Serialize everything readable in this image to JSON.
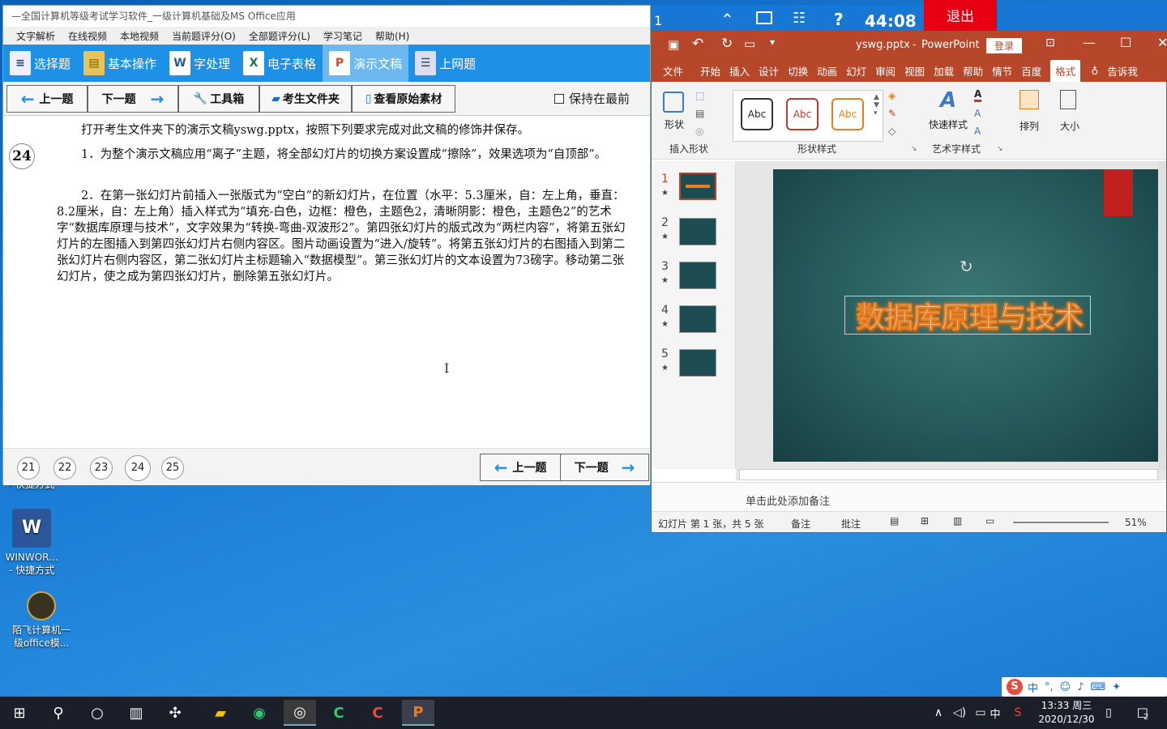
{
  "desktop": {
    "icon_partial_label": "- 快捷方式",
    "icons": [
      {
        "label1": "WINWOR...",
        "label2": "- 快捷方式"
      },
      {
        "label1": "陌飞计算机一",
        "label2": "级office模..."
      }
    ]
  },
  "exam": {
    "title": "—全国计算机等级考试学习软件_一级计算机基础及MS Office应用",
    "menu": [
      "文字解析",
      "在线视频",
      "本地视频",
      "当前题评分(O)",
      "全部题评分(L)",
      "学习笔记",
      "帮助(H)"
    ],
    "modules": [
      "选择题",
      "基本操作",
      "字处理",
      "电子表格",
      "演示文稿",
      "上网题"
    ],
    "toolbar": {
      "prev": "上一题",
      "next": "下一题",
      "toolbox": "工具箱",
      "folder": "考生文件夹",
      "view_source": "查看原始素材",
      "keep_front": "保持在最前"
    },
    "question_number": "24",
    "intro": "打开考生文件夹下的演示文稿yswg.pptx，按照下列要求完成对此文稿的修饰并保存。",
    "q1": "1．为整个演示文稿应用“离子”主题，将全部幻灯片的切换方案设置成“擦除”，效果选项为“自顶部”。",
    "q2": "2．在第一张幻灯片前插入一张版式为“空白”的新幻灯片，在位置（水平：5.3厘米，自：左上角，垂直：8.2厘米，自：左上角）插入样式为“填充-白色，边框：橙色，主题色2，清晰阴影：橙色，主题色2”的艺术字“数据库原理与技术”，文字效果为“转换-弯曲-双波形2”。第四张幻灯片的版式改为“两栏内容”，将第五张幻灯片的左图插入到第四张幻灯片右侧内容区。图片动画设置为“进入/旋转”。将第五张幻灯片的右图插入到第二张幻灯片右侧内容区，第二张幻灯片主标题输入“数据模型”。第三张幻灯片的文本设置为73磅字。移动第二张幻灯片，使之成为第四张幻灯片，删除第五张幻灯片。",
    "page_numbers": [
      "21",
      "22",
      "23",
      "24",
      "25"
    ],
    "bottom_prev": "上一题",
    "bottom_next": "下一题"
  },
  "timer": {
    "left": "1",
    "time": "44:08",
    "exit": "退出"
  },
  "ppt": {
    "file": "yswg.pptx",
    "dash": "-",
    "app": "PowerPoint",
    "login": "登录",
    "tabs": [
      "文件",
      "开始",
      "插入",
      "设计",
      "切换",
      "动画",
      "幻灯",
      "审阅",
      "视图",
      "加载",
      "帮助",
      "情节",
      "百度",
      "格式",
      "告诉我"
    ],
    "ribbon": {
      "shape_label": "形状",
      "group_insert": "插入形状",
      "abc": "Abc",
      "group_style": "形状样式",
      "quick_style": "快速样式",
      "group_art": "艺术字样式",
      "arrange": "排列",
      "size": "大小"
    },
    "slides": [
      "1",
      "2",
      "3",
      "4",
      "5"
    ],
    "star": "★",
    "wordart": "数据库原理与技术",
    "notes_placeholder": "单击此处添加备注",
    "status": {
      "slide_info": "幻灯片 第 1 张，共 5 张",
      "notes": "备注",
      "comments": "批注",
      "zoom": "51%"
    }
  },
  "taskbar": {
    "ime": "中",
    "time": "13:33 周三",
    "date": "2020/12/30",
    "notif": "2"
  },
  "ime_bar": {
    "mode": "中"
  }
}
